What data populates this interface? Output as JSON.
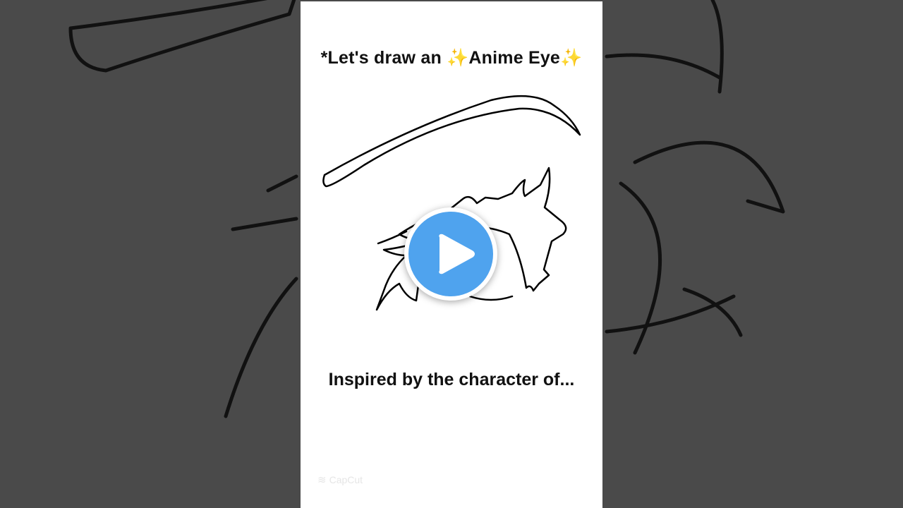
{
  "video": {
    "title_prefix": "*Let's draw an ",
    "title_sparkle": "✨",
    "title_subject": "Anime Eye",
    "caption": "Inspired by the character of...",
    "watermark_glyph": "≋",
    "watermark_text": "CapCut"
  },
  "controls": {
    "play_icon": "play-icon"
  },
  "colors": {
    "background": "#4a4a4a",
    "frame": "#ffffff",
    "play_button": "#4fa3ee",
    "sparkle": "#f2c12e"
  }
}
